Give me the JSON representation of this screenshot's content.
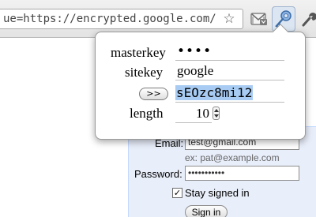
{
  "browser": {
    "url": "ue=https://encrypted.google.com/",
    "star_glyph": "☆",
    "extensions": [
      "gmail-checker-icon",
      "key-icon"
    ],
    "menu_icon": "wrench-icon"
  },
  "popup": {
    "masterkey_label": "masterkey",
    "masterkey_value": "••••",
    "sitekey_label": "sitekey",
    "sitekey_value": "google",
    "generate_label": ">>",
    "password_value": "sEOzc8mi12",
    "length_label": "length",
    "length_value": "10"
  },
  "login": {
    "email_label": "Email:",
    "email_value": "test@gmail.com",
    "email_hint": "ex: pat@example.com",
    "password_label": "Password:",
    "password_value": "•••••••••••",
    "stay_signed_in_label": "Stay signed in",
    "stay_signed_in_checked": "✓",
    "signin_label": "Sign in"
  },
  "colors": {
    "selection": "#a7cbf2",
    "login_bg": "#e8eefa",
    "login_border": "#c3d9ff"
  }
}
